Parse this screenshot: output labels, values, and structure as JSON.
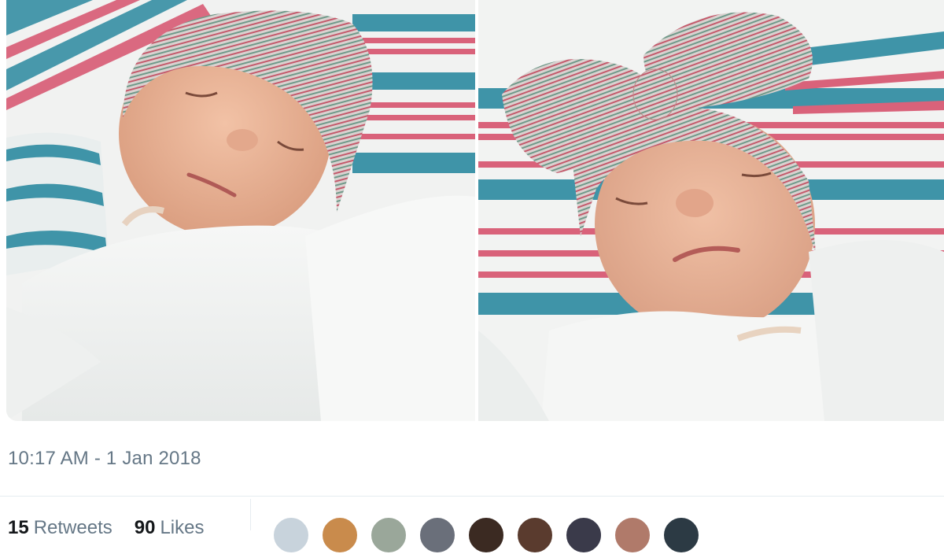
{
  "tweet": {
    "timestamp": "10:17 AM - 1 Jan 2018",
    "retweets": {
      "count": "15",
      "label": "Retweets"
    },
    "likes": {
      "count": "90",
      "label": "Likes"
    }
  },
  "photos": [
    {
      "subject": "newborn-baby-left",
      "hat": "striped-knit-hat"
    },
    {
      "subject": "newborn-baby-right",
      "hat": "striped-knit-bow-hat"
    }
  ],
  "colors": {
    "muted_text": "#657786",
    "primary_text": "#14171a",
    "blanket_blue": "#3f94a8",
    "blanket_pink": "#d9627a"
  },
  "avatars": [
    {
      "name": "default-avatar",
      "color": "#c8d3dc"
    },
    {
      "name": "user-avatar-2",
      "color": "#c98b4c"
    },
    {
      "name": "user-avatar-3",
      "color": "#9aa79a"
    },
    {
      "name": "user-avatar-4",
      "color": "#6a6f7a"
    },
    {
      "name": "user-avatar-5",
      "color": "#3b2a22"
    },
    {
      "name": "user-avatar-6",
      "color": "#5a3b2e"
    },
    {
      "name": "user-avatar-7",
      "color": "#3a3a4a"
    },
    {
      "name": "user-avatar-8",
      "color": "#b07a6a"
    },
    {
      "name": "user-avatar-9",
      "color": "#2c3a44"
    }
  ]
}
